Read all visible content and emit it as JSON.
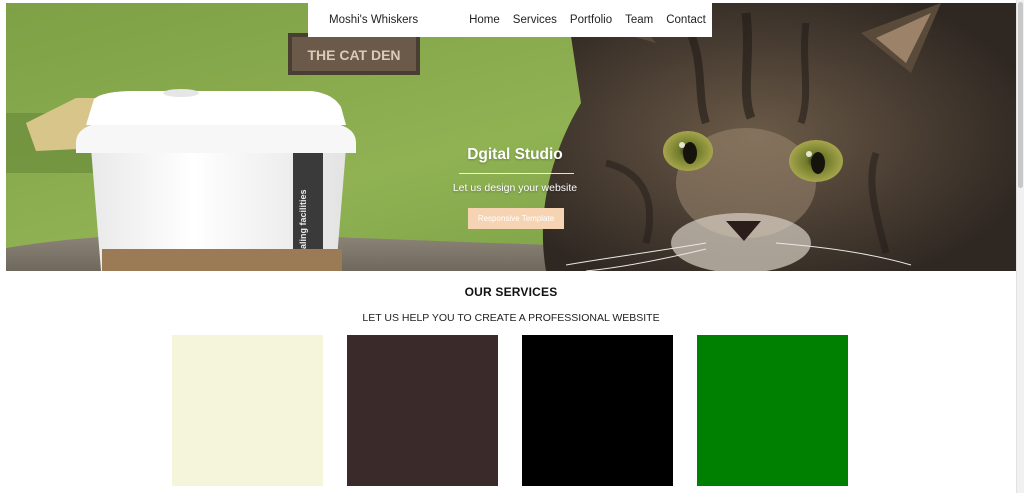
{
  "navbar": {
    "brand": "Moshi's Whiskers",
    "links": [
      "Home",
      "Services",
      "Portfolio",
      "Team",
      "Contact"
    ]
  },
  "hero": {
    "title": "Dgital Studio",
    "subtitle": "Let us design your website",
    "button_label": "Responsive Template",
    "sign_text": "THE CAT DEN",
    "cup_text": "aling facilities"
  },
  "services": {
    "title": "OUR SERVICES",
    "subtitle": "LET US HELP YOU TO CREATE A PROFESSIONAL WEBSITE",
    "cards": [
      {
        "color": "#f5f5dc"
      },
      {
        "color": "#3b2a2a"
      },
      {
        "color": "#000000"
      },
      {
        "color": "#008000"
      }
    ]
  },
  "colors": {
    "accent_button": "#f6d3b3",
    "hero_wall": "#8fb04f"
  }
}
